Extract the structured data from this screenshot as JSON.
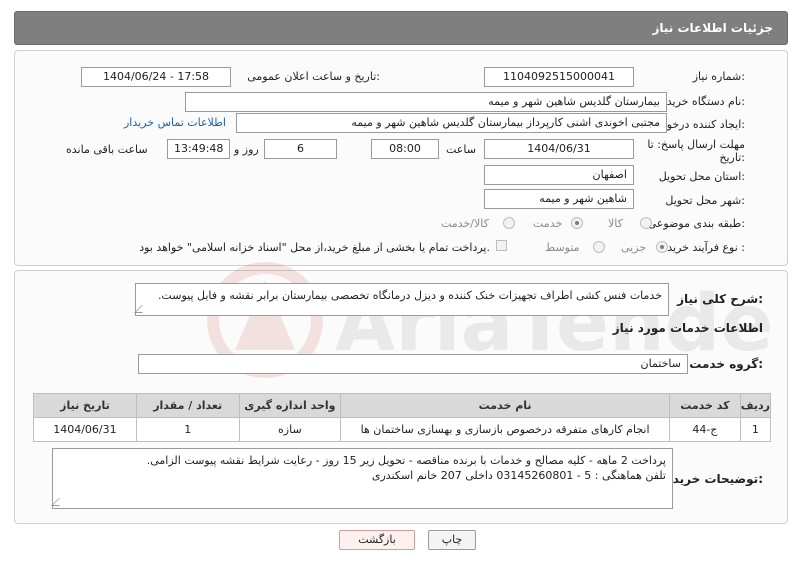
{
  "header": {
    "title": "جزئیات اطلاعات نیاز"
  },
  "need_info": {
    "need_number_label": "شماره نیاز:",
    "need_number": "1104092515000041",
    "announce_label": "تاریخ و ساعت اعلان عمومی:",
    "announce_value": "1404/06/24 - 17:58",
    "buyer_org_label": "نام دستگاه خریدار:",
    "buyer_org": "بیمارستان گلدیس  شاهین شهر و میمه",
    "requester_label": "ایجاد کننده درخواست:",
    "requester": "مجتبی اخوندی اشنی کارپرداز بیمارستان گلدیس  شاهین شهر و میمه",
    "contact_link": "اطلاعات تماس خریدار",
    "deadline_label_1": "مهلت ارسال پاسخ: تا",
    "deadline_label_2": "تاریخ:",
    "deadline_date": "1404/06/31",
    "time_label": "ساعت",
    "deadline_time": "08:00",
    "days_value": "6",
    "days_label": "روز و",
    "remaining_time": "13:49:48",
    "remaining_label": "ساعت باقی مانده",
    "province_label": "استان محل تحویل:",
    "province": "اصفهان",
    "city_label": "شهر محل تحویل:",
    "city": "شاهین شهر و میمه",
    "category_label": "طبقه بندی موضوعی:",
    "category_options": [
      "کالا",
      "خدمت",
      "کالا/خدمت"
    ],
    "category_selected": "خدمت",
    "process_label": "نوع فرآیند خرید :",
    "process_options": [
      "جزیی",
      "متوسط"
    ],
    "process_selected": "جزیی",
    "treasury_note": "پرداخت تمام یا بخشی از مبلغ خرید،از محل \"اسناد خزانه اسلامی\" خواهد بود."
  },
  "description": {
    "label": "شرح کلی نیاز:",
    "text": "خدمات فنس کشی اطراف تجهیزات خنک کننده و دیزل درمانگاه تخصصی بیمارستان برابر نقشه و فایل پیوست."
  },
  "services": {
    "section_title": "اطلاعات خدمات مورد نیاز",
    "group_label": "گروه خدمت:",
    "group_value": "ساختمان",
    "columns": [
      "ردیف",
      "کد خدمت",
      "نام خدمت",
      "واحد اندازه گیری",
      "تعداد / مقدار",
      "تاریخ نیاز"
    ],
    "rows": [
      [
        "1",
        "ج-44",
        "انجام کارهای متفرقه درخصوص بازسازی و بهسازی ساختمان ها",
        "سازه",
        "1",
        "1404/06/31"
      ]
    ]
  },
  "buyer_notes": {
    "label": "توضیحات خریدار:",
    "line1": "پرداخت 2 ماهه - کلیه مصالح و خدمات با برنده مناقصه - تحویل زیر 15 روز - رعایت شرایط نقشه پیوست الزامی.",
    "line2": "تلفن هماهنگی : 5 - 03145260801 داخلی 207 خانم اسکندری"
  },
  "buttons": {
    "print": "چاپ",
    "back": "بازگشت"
  },
  "watermark": {
    "text": "AriaTender.net"
  }
}
